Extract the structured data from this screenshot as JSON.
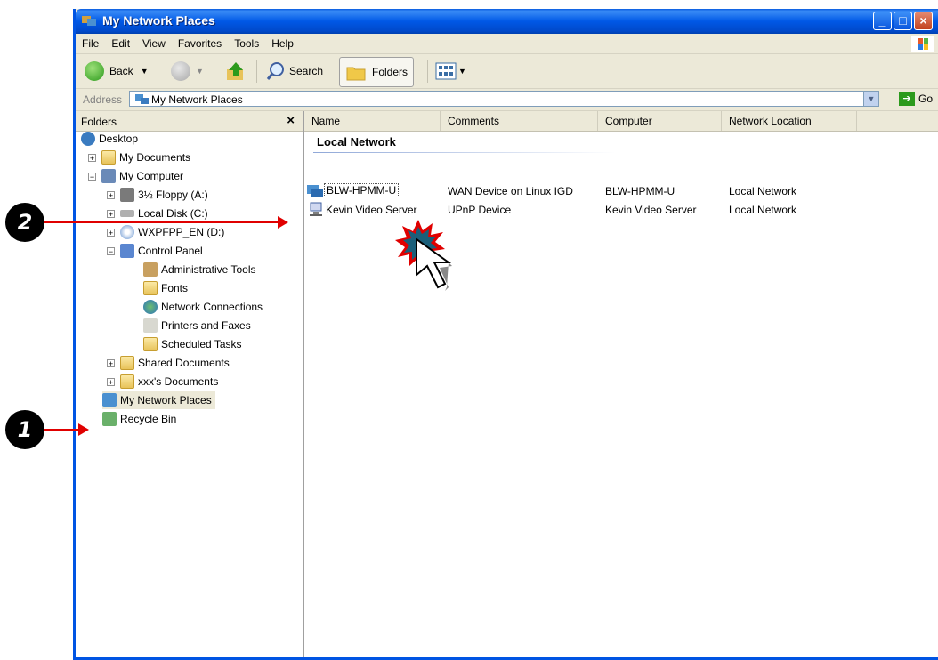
{
  "window": {
    "title": "My Network Places"
  },
  "menu": [
    "File",
    "Edit",
    "View",
    "Favorites",
    "Tools",
    "Help"
  ],
  "toolbar": {
    "back_label": "Back",
    "search_label": "Search",
    "folders_label": "Folders"
  },
  "address": {
    "label": "Address",
    "value": "My Network Places",
    "go_label": "Go"
  },
  "folders_pane": {
    "title": "Folders",
    "close_glyph": "×",
    "items": [
      {
        "label": "Desktop",
        "icon": "desktop-icon"
      },
      {
        "label": "My Documents",
        "icon": "folder-icon"
      },
      {
        "label": "My Computer",
        "icon": "computer-icon"
      },
      {
        "label": "3½ Floppy (A:)",
        "icon": "floppy-icon"
      },
      {
        "label": "Local Disk (C:)",
        "icon": "disk-icon"
      },
      {
        "label": "WXPFPP_EN (D:)",
        "icon": "cd-icon"
      },
      {
        "label": "Control Panel",
        "icon": "control-panel-icon"
      },
      {
        "label": "Administrative Tools",
        "icon": "admin-tools-icon"
      },
      {
        "label": "Fonts",
        "icon": "fonts-folder-icon"
      },
      {
        "label": "Network Connections",
        "icon": "network-connections-icon"
      },
      {
        "label": "Printers and Faxes",
        "icon": "printer-icon"
      },
      {
        "label": "Scheduled Tasks",
        "icon": "scheduled-tasks-icon"
      },
      {
        "label": "Shared Documents",
        "icon": "folder-icon"
      },
      {
        "label": "xxx's Documents",
        "icon": "folder-icon"
      },
      {
        "label": "My Network Places",
        "icon": "network-places-icon"
      },
      {
        "label": "Recycle Bin",
        "icon": "recycle-bin-icon"
      }
    ]
  },
  "columns": [
    "Name",
    "Comments",
    "Computer",
    "Network Location"
  ],
  "group": {
    "title": "Local Network"
  },
  "rows": [
    {
      "name": "BLW-HPMM-U",
      "comments": "WAN Device on Linux IGD",
      "computer": "BLW-HPMM-U",
      "location": "Local Network"
    },
    {
      "name": "Kevin Video Server",
      "comments": "UPnP Device",
      "computer": "Kevin Video Server",
      "location": "Local Network"
    }
  ],
  "annotations": {
    "step1": "1",
    "step2": "2"
  },
  "colors": {
    "annotation_arrow": "#e00000",
    "titlebar": "#0058e6",
    "selection_burst": "#e00000"
  }
}
